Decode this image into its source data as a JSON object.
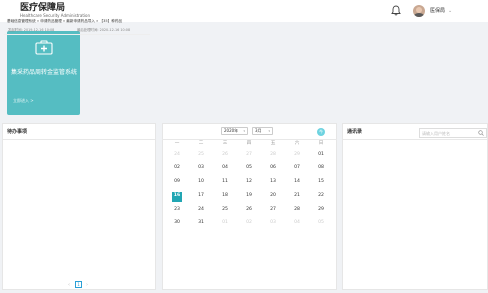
{
  "header": {
    "title": "医疗保障局",
    "subtitle": "Healthcare Security Administration",
    "user_name": "医保局",
    "caret": "⌄"
  },
  "tile": {
    "title": "集采药品周转金监管系统",
    "link": "立即进入 >",
    "color": "#55bdc2"
  },
  "todo": {
    "title": "待办事项",
    "items": [
      {
        "text": "基础信息管理系统 » 申请药品管理 » 最新申请药品导入 » 【35】种药品",
        "created": "发起时间: 2019-12-16 10:08",
        "deadline": "最后处理时间: 2020-12-16 10:08"
      }
    ],
    "pagination": {
      "prev": "‹",
      "page": "1",
      "next": "›"
    }
  },
  "calendar": {
    "year": "2020年",
    "month": "3月",
    "dd": "▾",
    "today_button": "今",
    "weekdays": [
      "一",
      "二",
      "三",
      "四",
      "五",
      "六",
      "日"
    ],
    "weeks": [
      [
        "24",
        "25",
        "26",
        "27",
        "28",
        "29",
        "01"
      ],
      [
        "02",
        "03",
        "04",
        "05",
        "06",
        "07",
        "08"
      ],
      [
        "09",
        "10",
        "11",
        "12",
        "13",
        "14",
        "15"
      ],
      [
        "16",
        "17",
        "18",
        "19",
        "20",
        "21",
        "22"
      ],
      [
        "23",
        "24",
        "25",
        "26",
        "27",
        "28",
        "29"
      ],
      [
        "30",
        "31",
        "01",
        "02",
        "03",
        "04",
        "05"
      ]
    ],
    "selected": "16",
    "accent": "#22a6b3"
  },
  "address": {
    "title": "通讯录",
    "search_placeholder": "请输入用户姓名"
  }
}
